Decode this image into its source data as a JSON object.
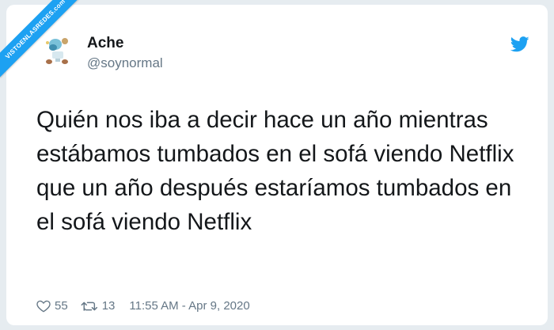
{
  "watermark": {
    "text": "VISTOENLASREDES",
    "sub": ".com"
  },
  "tweet": {
    "author_name": "Ache",
    "author_handle": "@soynormal",
    "text": "Quién nos iba a decir hace un año mientras estábamos tumbados en el sofá viendo Netflix que un año después estaríamos tumbados en el sofá viendo Netflix",
    "likes": "55",
    "retweets": "13",
    "timestamp": "11:55 AM - Apr 9, 2020"
  },
  "icons": {
    "brand": "twitter-bird-icon",
    "like": "heart-icon",
    "retweet": "retweet-icon"
  },
  "colors": {
    "brand": "#1da1f2",
    "text": "#14171a",
    "muted": "#657786",
    "background": "#e6ecf0"
  }
}
